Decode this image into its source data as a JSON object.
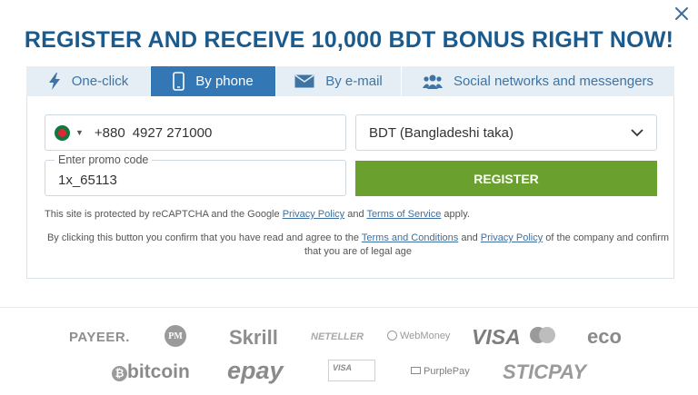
{
  "modal": {
    "title": "REGISTER AND RECEIVE 10,000 BDT BONUS RIGHT NOW!"
  },
  "tabs": [
    {
      "label": "One-click",
      "icon": "lightning-icon"
    },
    {
      "label": "By phone",
      "icon": "phone-icon",
      "active": true
    },
    {
      "label": "By e-mail",
      "icon": "envelope-icon"
    },
    {
      "label": "Social networks and messengers",
      "icon": "users-icon"
    }
  ],
  "form": {
    "phone_code": "+880",
    "phone_number": "4927 271000",
    "currency": "BDT (Bangladeshi taka)",
    "promo_label": "Enter promo code",
    "promo_value": "1x_65113",
    "register_label": "REGISTER"
  },
  "notes": {
    "recaptcha_prefix": "This site is protected by reCAPTCHA and the Google",
    "privacy_policy": "Privacy Policy",
    "and": "and",
    "terms_of_service": "Terms of Service",
    "apply": "apply.",
    "confirm_prefix": "By clicking this button you confirm that you have read and agree to the",
    "terms_and_conditions": "Terms and Conditions",
    "confirm_suffix": "of the company and confirm that you are of legal age"
  },
  "payments": {
    "payeer": "PAYEER.",
    "pm": "PM",
    "skrill": "Skrill",
    "neteller": "NETELLER",
    "webmoney": "WebMoney",
    "visa": "VISA",
    "eco": "eco",
    "bitcoin": "bitcoin",
    "epay": "epay",
    "visa_small": "VISA",
    "purplepay": "PurplePay",
    "sticpay": "STICPAY"
  },
  "colors": {
    "title": "#1a5a8c",
    "tab_active": "#3477b5",
    "register": "#6aa12e"
  }
}
